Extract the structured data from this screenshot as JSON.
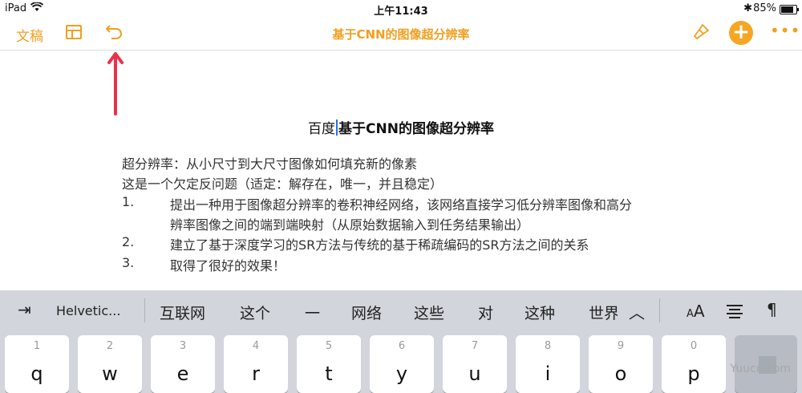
{
  "status_bar": {
    "device": "iPad",
    "time": "上午11:43",
    "battery": "85%",
    "battery_level": 0.85
  },
  "toolbar": {
    "docs_label": "文稿",
    "title": "基于CNN的图像超分辨率",
    "add_label": "+",
    "more_label": "•••"
  },
  "document": {
    "title_prefix": "百度",
    "title_main": "基于CNN的图像超分辨率",
    "paragraphs": [
      "超分辨率：从小尺寸到大尺寸图像如何填充新的像素",
      "这是一个欠定反问题（适定：解存在，唯一，并且稳定）"
    ],
    "list": [
      {
        "num": "1.",
        "lines": [
          "提出一种用于图像超分辨率的卷积神经网络，该网络直接学习低分辨率图像和高分",
          "辨率图像之间的端到端映射（从原始数据输入到任务结果输出）"
        ]
      },
      {
        "num": "2.",
        "lines": [
          "建立了基于深度学习的SR方法与传统的基于稀疏编码的SR方法之间的关系"
        ]
      },
      {
        "num": "3.",
        "lines": [
          "取得了很好的效果！"
        ]
      }
    ]
  },
  "predictive_bar": {
    "font_name": "Helvetic...",
    "suggestions": [
      "互联网",
      "这个",
      "一",
      "网络",
      "这些",
      "对",
      "这种",
      "世界"
    ],
    "size_small": "A",
    "size_big": "A",
    "paragraph_symbol": "¶"
  },
  "keyboard": {
    "keys": [
      {
        "num": "1",
        "ch": "q"
      },
      {
        "num": "2",
        "ch": "w"
      },
      {
        "num": "3",
        "ch": "e"
      },
      {
        "num": "4",
        "ch": "r"
      },
      {
        "num": "5",
        "ch": "t"
      },
      {
        "num": "6",
        "ch": "y"
      },
      {
        "num": "7",
        "ch": "u"
      },
      {
        "num": "8",
        "ch": "i"
      },
      {
        "num": "9",
        "ch": "o"
      },
      {
        "num": "0",
        "ch": "p"
      }
    ]
  },
  "watermark": "Yuucn.com",
  "colors": {
    "accent": "#f0a021",
    "annotation": "#e8324a",
    "cursor": "#2a6fe0",
    "keyboard_bg": "#d2d5db"
  }
}
